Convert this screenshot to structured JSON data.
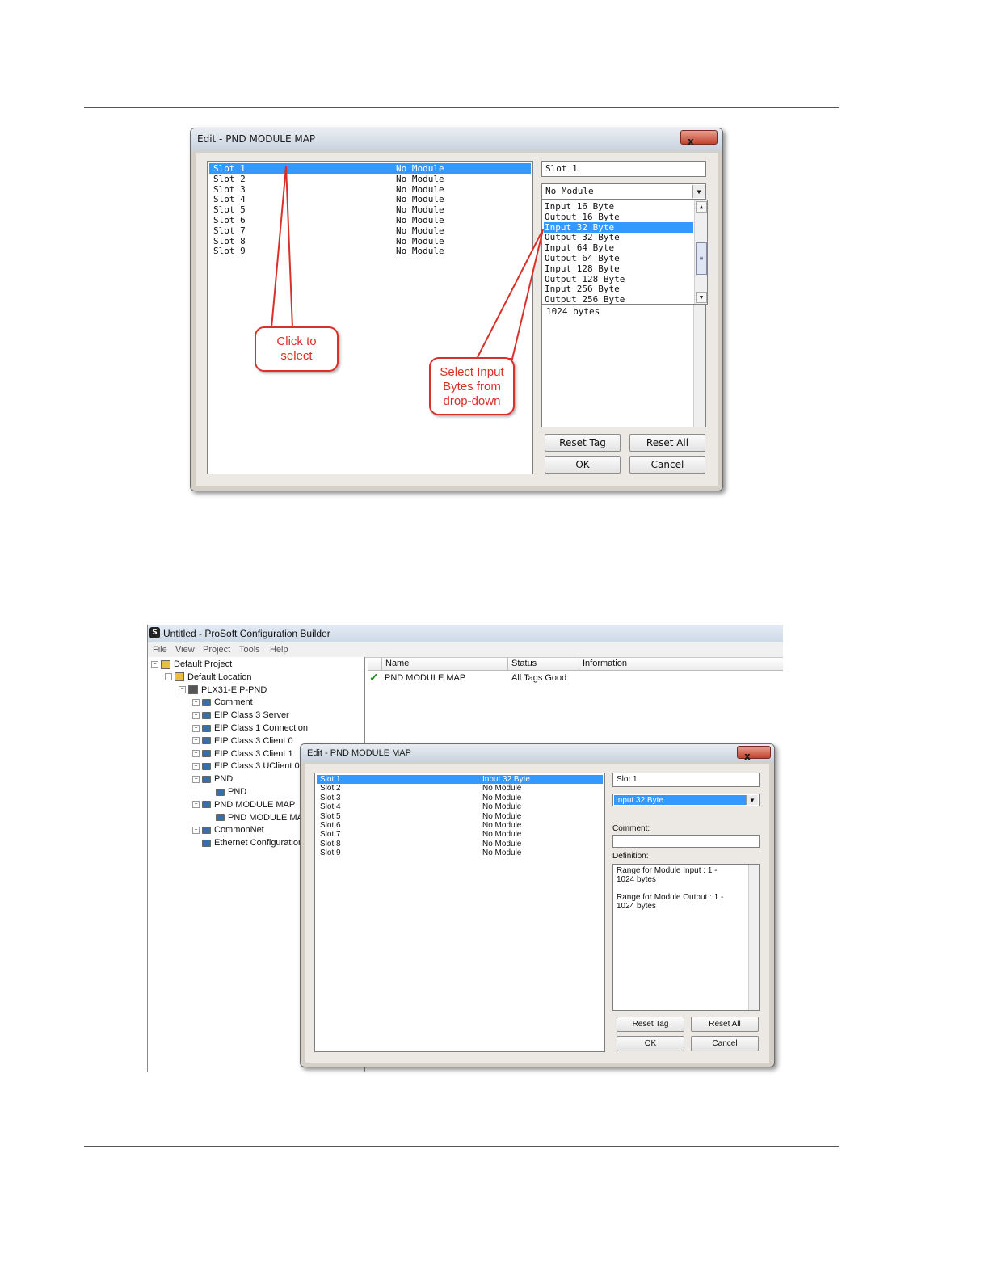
{
  "dialog1": {
    "title": "Edit - PND MODULE MAP",
    "close": "x",
    "slots": [
      {
        "name": "Slot 1",
        "value": "No Module"
      },
      {
        "name": "Slot 2",
        "value": "No Module"
      },
      {
        "name": "Slot 3",
        "value": "No Module"
      },
      {
        "name": "Slot 4",
        "value": "No Module"
      },
      {
        "name": "Slot 5",
        "value": "No Module"
      },
      {
        "name": "Slot 6",
        "value": "No Module"
      },
      {
        "name": "Slot 7",
        "value": "No Module"
      },
      {
        "name": "Slot 8",
        "value": "No Module"
      },
      {
        "name": "Slot 9",
        "value": "No Module"
      }
    ],
    "selected_slot_field": "Slot 1",
    "dropdown_value": "No Module",
    "dropdown_options": [
      "Input 16 Byte",
      "Output 16 Byte",
      "Input 32 Byte",
      "Output 32 Byte",
      "Input 64 Byte",
      "Output 64 Byte",
      "Input 128 Byte",
      "Output 128 Byte",
      "Input 256 Byte",
      "Output 256 Byte"
    ],
    "highlighted_option": "Input 32 Byte",
    "definition_partial": "1024 bytes",
    "buttons": {
      "reset_tag": "Reset Tag",
      "reset_all": "Reset All",
      "ok": "OK",
      "cancel": "Cancel"
    },
    "callout_click_line1": "Click to",
    "callout_click_line2": "select",
    "callout_select_line1": "Select Input",
    "callout_select_line2": "Bytes from",
    "callout_select_line3": "drop-down"
  },
  "window": {
    "title": "Untitled - ProSoft Configuration Builder",
    "menu": [
      "File",
      "View",
      "Project",
      "Tools",
      "Help"
    ],
    "tree": [
      {
        "label": "Default Project",
        "pm": "-",
        "level": 0
      },
      {
        "label": "Default Location",
        "pm": "-",
        "level": 1
      },
      {
        "label": "PLX31-EIP-PND",
        "pm": "-",
        "level": 2
      },
      {
        "label": "Comment",
        "pm": "+",
        "level": 3
      },
      {
        "label": "EIP Class 3 Server",
        "pm": "+",
        "level": 3
      },
      {
        "label": "EIP Class 1 Connection",
        "pm": "+",
        "level": 3
      },
      {
        "label": "EIP Class 3 Client 0",
        "pm": "+",
        "level": 3
      },
      {
        "label": "EIP Class 3 Client 1",
        "pm": "+",
        "level": 3
      },
      {
        "label": "EIP Class 3 UClient 0",
        "pm": "+",
        "level": 3
      },
      {
        "label": "PND",
        "pm": "-",
        "level": 3
      },
      {
        "label": "PND",
        "pm": "",
        "level": 4
      },
      {
        "label": "PND MODULE MAP",
        "pm": "-",
        "level": 3
      },
      {
        "label": "PND MODULE MA",
        "pm": "",
        "level": 4
      },
      {
        "label": "CommonNet",
        "pm": "+",
        "level": 3
      },
      {
        "label": "Ethernet Configuration",
        "pm": "",
        "level": 3
      }
    ],
    "grid_headers": [
      "Name",
      "Status",
      "Information"
    ],
    "grid_row": {
      "name": "PND MODULE MAP",
      "status": "All Tags Good",
      "information": ""
    }
  },
  "dialog2": {
    "title": "Edit - PND MODULE MAP",
    "close": "x",
    "slots": [
      {
        "name": "Slot 1",
        "value": "Input 32 Byte"
      },
      {
        "name": "Slot 2",
        "value": "No Module"
      },
      {
        "name": "Slot 3",
        "value": "No Module"
      },
      {
        "name": "Slot 4",
        "value": "No Module"
      },
      {
        "name": "Slot 5",
        "value": "No Module"
      },
      {
        "name": "Slot 6",
        "value": "No Module"
      },
      {
        "name": "Slot 7",
        "value": "No Module"
      },
      {
        "name": "Slot 8",
        "value": "No Module"
      },
      {
        "name": "Slot 9",
        "value": "No Module"
      }
    ],
    "selected_slot_field": "Slot 1",
    "dropdown_value": "Input 32 Byte",
    "comment_label": "Comment:",
    "comment_value": "",
    "definition_label": "Definition:",
    "definition_lines": [
      "Range for Module Input : 1 -",
      "1024 bytes",
      "",
      "Range for Module Output : 1 -",
      "1024 bytes"
    ],
    "buttons": {
      "reset_tag": "Reset Tag",
      "reset_all": "Reset All",
      "ok": "OK",
      "cancel": "Cancel"
    }
  }
}
